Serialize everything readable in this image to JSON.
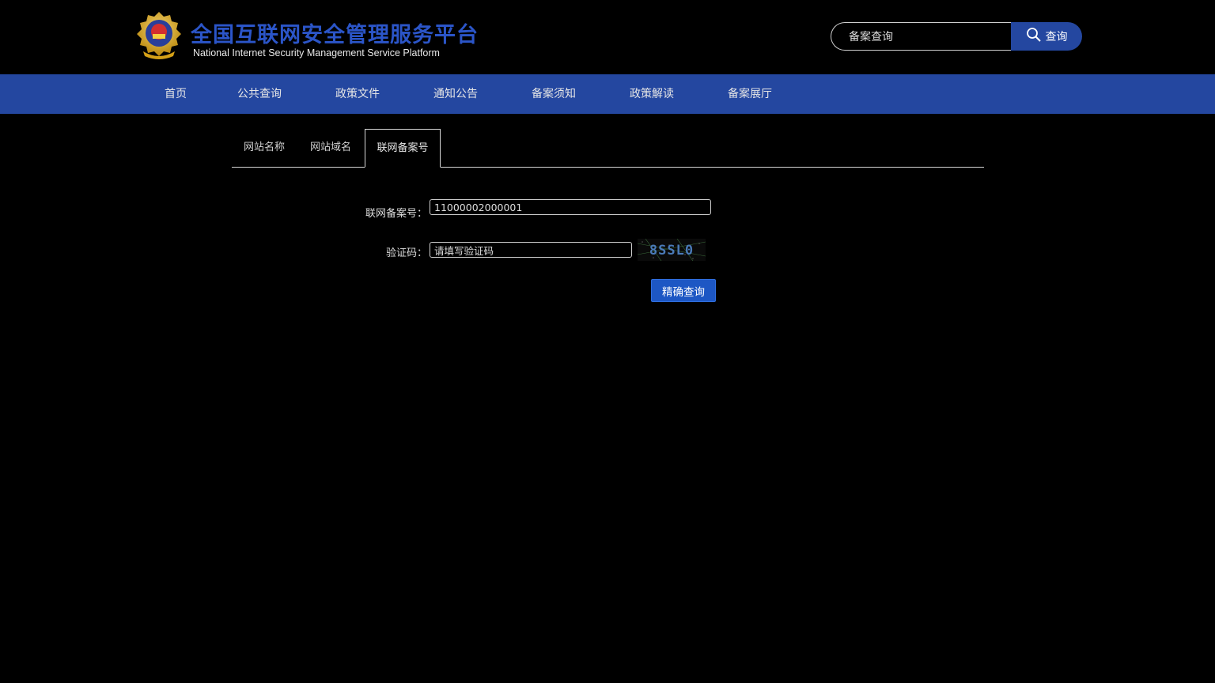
{
  "header": {
    "title_cn": "全国互联网安全管理服务平台",
    "title_en": "National Internet Security Management Service Platform",
    "search": {
      "value": "备案查询",
      "button_label": "查询"
    }
  },
  "nav": {
    "items": [
      {
        "label": "首页"
      },
      {
        "label": "公共查询"
      },
      {
        "label": "政策文件"
      },
      {
        "label": "通知公告"
      },
      {
        "label": "备案须知"
      },
      {
        "label": "政策解读"
      },
      {
        "label": "备案展厅"
      }
    ]
  },
  "tabs": [
    {
      "label": "网站名称",
      "active": false
    },
    {
      "label": "网站域名",
      "active": false
    },
    {
      "label": "联网备案号",
      "active": true
    }
  ],
  "form": {
    "record_label": "联网备案号：",
    "record_value": "11000002000001",
    "captcha_label": "验证码：",
    "captcha_value": "请填写验证码",
    "captcha_text": "8SSL0",
    "submit_label": "精确查询"
  },
  "colors": {
    "brand_blue": "#2447a0",
    "title_blue": "#2b55c8",
    "button_blue": "#1d57c4"
  }
}
